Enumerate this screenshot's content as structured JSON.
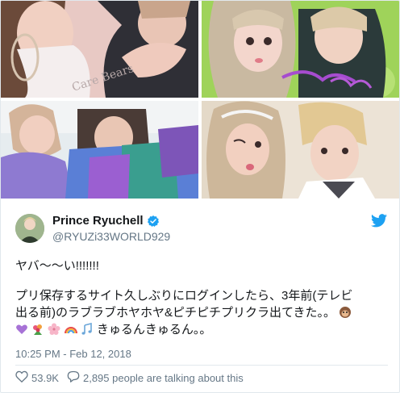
{
  "tweet": {
    "display_name": "Prince Ryuchell",
    "handle": "@RYUZi33WORLD929",
    "text_line1": "ヤバ〜〜い!!!!!!!",
    "text_line2": "プリ保存するサイト久しぶりにログインしたら、3年前(テレビ",
    "text_line3": "出る前)のラブラブホヤホヤ&ピチピチプリクラ出てきた。。",
    "text_line4": "きゅるんきゅるん。。",
    "timestamp": "10:25 PM - Feb 12, 2018",
    "likes": "53.9K",
    "talking": "2,895 people are talking about this"
  },
  "photos": {
    "shirt_text": "Care Bears"
  },
  "icons": {
    "verified": "verified-badge-icon",
    "brand": "twitter-bird-icon",
    "like": "heart-icon",
    "comment": "speech-bubble-icon"
  },
  "colors": {
    "brand_blue": "#1da1f2",
    "secondary_text": "#657786",
    "primary_text": "#14171a"
  }
}
